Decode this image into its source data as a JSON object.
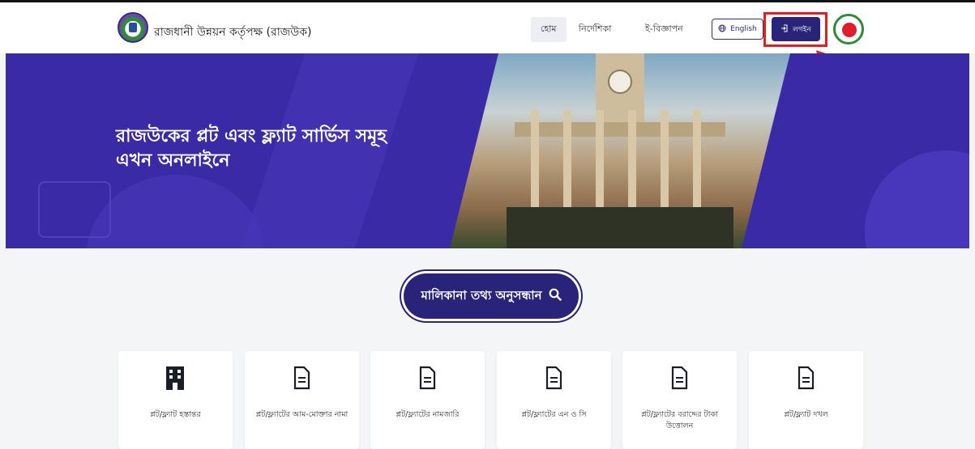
{
  "header": {
    "brand": "রাজধানী উন্নয়ন কর্তৃপক্ষ (রাজউক)",
    "nav": [
      "হোম",
      "নির্দেশিকা",
      "ই-বিজ্ঞাপন"
    ],
    "english_label": "English",
    "login_label": "লগইন"
  },
  "hero": {
    "title_line1": "রাজউকের প্লট এবং ফ্ল্যাট সার্ভিস সমূহ",
    "title_line2": "এখন অনলাইনে"
  },
  "search": {
    "label": "মালিকানা তথ্য অনুসন্ধান"
  },
  "services": [
    {
      "label": "প্লট/ফ্ল্যাট হস্তান্তর",
      "icon": "building-icon"
    },
    {
      "label": "প্লট/ফ্ল্যাটের আম-মোক্তার নামা",
      "icon": "document-icon"
    },
    {
      "label": "প্লট/ফ্ল্যাটের নামজারি",
      "icon": "document-icon"
    },
    {
      "label": "প্লট/ফ্ল্যাটের এন ও সি",
      "icon": "document-icon"
    },
    {
      "label": "প্লট/ফ্ল্যাটের বরাদ্দের টাকা উত্তোলন",
      "icon": "document-icon"
    },
    {
      "label": "প্লট/ফ্ল্যাট দখল",
      "icon": "document-icon"
    }
  ],
  "colors": {
    "primary": "#2a237a",
    "hero": "#3b2aa6",
    "highlight": "#e21e1e"
  }
}
